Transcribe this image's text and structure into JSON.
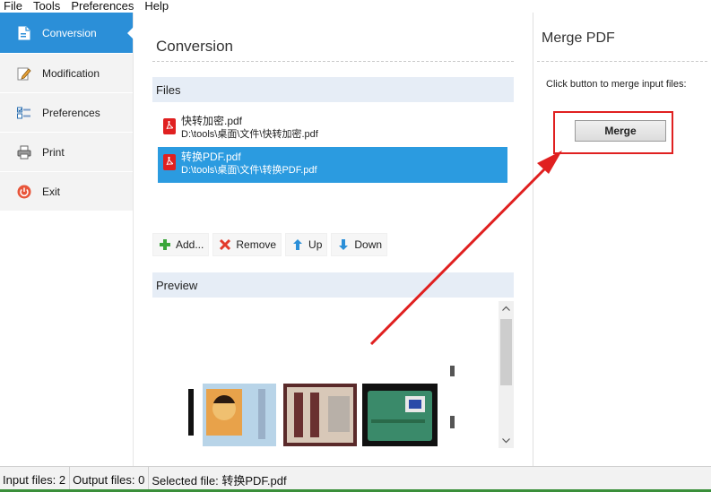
{
  "menu": {
    "items": [
      {
        "label": "File"
      },
      {
        "label": "Tools"
      },
      {
        "label": "Preferences"
      },
      {
        "label": "Help"
      }
    ]
  },
  "sidebar": {
    "items": [
      {
        "label": "Conversion",
        "icon": "convert-document-icon",
        "active": true
      },
      {
        "label": "Modification",
        "icon": "edit-document-icon",
        "active": false
      },
      {
        "label": "Preferences",
        "icon": "preferences-checklist-icon",
        "active": false
      },
      {
        "label": "Print",
        "icon": "printer-icon",
        "active": false
      },
      {
        "label": "Exit",
        "icon": "power-icon",
        "active": false
      }
    ]
  },
  "main": {
    "title": "Conversion",
    "files_section": "Files",
    "files": [
      {
        "name": "快转加密.pdf",
        "path": "D:\\tools\\桌面\\文件\\快转加密.pdf",
        "selected": false
      },
      {
        "name": "转换PDF.pdf",
        "path": "D:\\tools\\桌面\\文件\\转换PDF.pdf",
        "selected": true
      }
    ],
    "actions": {
      "add": "Add...",
      "remove": "Remove",
      "up": "Up",
      "down": "Down"
    },
    "preview_section": "Preview"
  },
  "right": {
    "title": "Merge PDF",
    "hint": "Click button to merge input files:",
    "merge_button": "Merge"
  },
  "status": {
    "input_files": "Input files: 2",
    "output_files": "Output files: 0",
    "selected_file": "Selected file: 转换PDF.pdf"
  },
  "colors": {
    "accent": "#2b8fd8",
    "selection": "#2b9be0",
    "annotation_red": "#e02020",
    "section_bg": "#e6edf6"
  }
}
